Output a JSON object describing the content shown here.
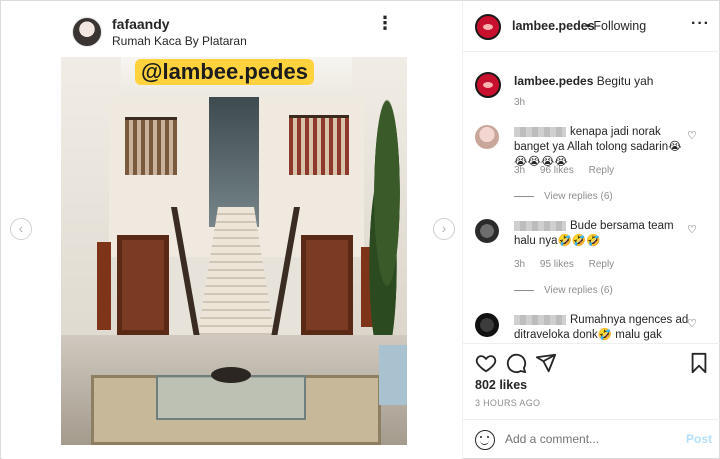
{
  "media": {
    "repost_user": "fafaandy",
    "repost_location": "Rumah Kaca By Plataran",
    "watermark": "@lambee.pedes",
    "nav_prev": "‹",
    "nav_next": "›",
    "more_icon": "⋮"
  },
  "panel": {
    "header": {
      "username": "lambee.pedes",
      "separator": "•",
      "follow_status": "Following",
      "more_icon": "···"
    },
    "caption": {
      "username": "lambee.pedes",
      "text": "Begitu yah",
      "time": "3h"
    },
    "comments": [
      {
        "text": "kenapa jadi norak banget ya Allah tolong sadarin😭😭😭😭😭",
        "time": "3h",
        "likes": "96 likes",
        "reply": "Reply",
        "view_replies": "View replies (6)"
      },
      {
        "text": "Bude bersama team halu nya🤣🤣🤣",
        "time": "3h",
        "likes": "95 likes",
        "reply": "Reply",
        "view_replies": "View replies (6)"
      },
      {
        "text": "Rumahnya ngences ad ditraveloka donk🤣 malu gak"
      }
    ],
    "actions": {
      "likes": "802 likes",
      "ago": "3 HOURS AGO"
    },
    "add_comment": {
      "placeholder": "Add a comment...",
      "post_label": "Post"
    }
  },
  "colors": {
    "accent_blue": "#b2dffc",
    "muted": "#8e8e8e",
    "avatar_red": "#c8102e",
    "watermark_bg": "#ffd23e"
  }
}
